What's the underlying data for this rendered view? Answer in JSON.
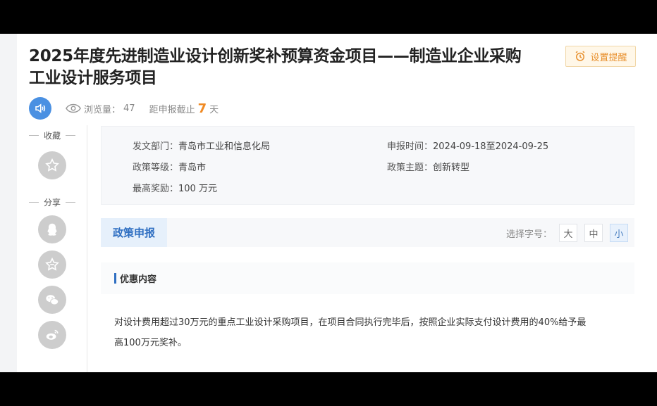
{
  "page": {
    "title": "2025年度先进制造业设计创新奖补预算资金项目——制造业企业采购工业设计服务项目",
    "remind_label": "设置提醒",
    "views_label": "浏览量：",
    "views_count": "47",
    "deadline_prefix": "距申报截止",
    "deadline_days": "7",
    "deadline_suffix": "天"
  },
  "sidebar": {
    "collect_label": "收藏",
    "share_label": "分享",
    "icons": [
      "star-icon",
      "qq-icon",
      "favorite-icon",
      "wechat-icon",
      "weibo-icon"
    ]
  },
  "info": {
    "dept_label": "发文部门：",
    "dept_value": "青岛市工业和信息化局",
    "date_label": "申报时间：",
    "date_value": "2024-09-18至2024-09-25",
    "level_label": "政策等级：",
    "level_value": "青岛市",
    "theme_label": "政策主题：",
    "theme_value": "创新转型",
    "reward_label": "最高奖励：",
    "reward_value": "100 万元"
  },
  "tabs": {
    "active_label": "政策申报",
    "font_size_label": "选择字号：",
    "sizes": [
      "大",
      "中",
      "小"
    ],
    "selected_size": "小"
  },
  "content": {
    "section_title": "优惠内容",
    "paragraph_line1": "对设计费用超过30万元的重点工业设计采购项目，在项目合同执行完毕后，按照企业实际支付设计费用的40%给予最",
    "paragraph_line2": "高100万元奖补。"
  },
  "colors": {
    "accent_blue": "#2f6fc2",
    "orange": "#f08a24",
    "speaker_blue": "#4a90e2"
  }
}
